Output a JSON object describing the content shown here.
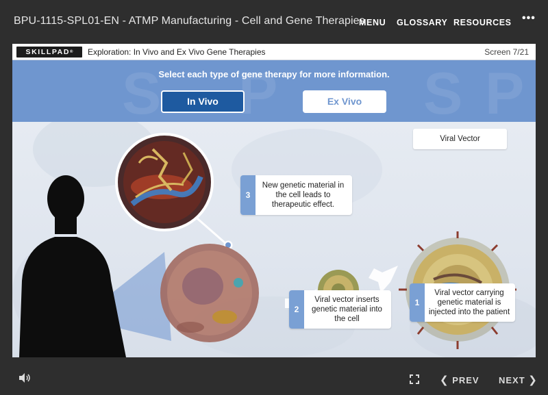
{
  "header": {
    "course_title": "BPU-1115-SPL01-EN - ATMP Manufacturing - Cell and Gene Therapies",
    "menu_label": "MENU",
    "glossary_label": "GLOSSARY",
    "resources_label": "RESOURCES",
    "more_icon": "more-dots-icon"
  },
  "slide": {
    "logo_text": "SKILLPAD",
    "logo_mark": "®",
    "screen_title": "Exploration: In Vivo and Ex Vivo Gene Therapies",
    "screen_counter": "Screen 7/21",
    "instruction": "Select each type of gene therapy for more information.",
    "tabs": [
      {
        "label": "In Vivo",
        "selected": true
      },
      {
        "label": "Ex Vivo",
        "selected": false
      }
    ],
    "viral_vector_label": "Viral Vector",
    "steps": [
      {
        "number": "1",
        "text": "Viral vector carrying genetic material is injected into the patient"
      },
      {
        "number": "2",
        "text": "Viral vector inserts genetic material into the cell"
      },
      {
        "number": "3",
        "text": "New genetic material in the cell leads to therapeutic effect."
      }
    ],
    "accent_color": "#6f96cf",
    "active_tab_color": "#1e5aa0"
  },
  "footer": {
    "audio_icon": "speaker-icon",
    "fullscreen_icon": "fullscreen-icon",
    "prev_label": "PREV",
    "next_label": "NEXT"
  }
}
